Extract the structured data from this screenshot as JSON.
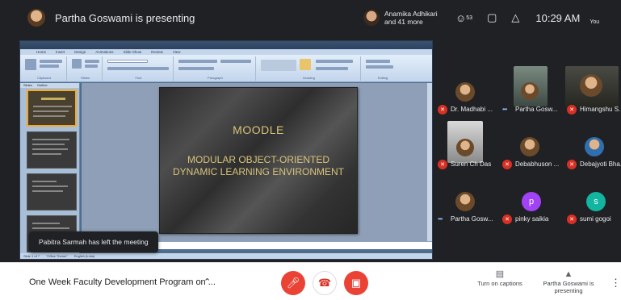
{
  "top": {
    "presenter_label": "Partha Goswami is presenting",
    "participants_text": "Anamika Adhikari and 41 more",
    "participant_count": "53",
    "time": "10:29 AM",
    "you_label": "You"
  },
  "ppt": {
    "tabs": [
      "Home",
      "Insert",
      "Design",
      "Animations",
      "Slide Show",
      "Review",
      "View"
    ],
    "ribbon_groups": [
      "Clipboard",
      "Slides",
      "Font",
      "Paragraph",
      "Drawing",
      "Editing"
    ],
    "thumb_tabs": [
      "Slides",
      "Outline"
    ],
    "status": [
      "Slide 1 of 7",
      "\"Office Theme\"",
      "English (India)"
    ]
  },
  "slide": {
    "title": "MOODLE",
    "subtitle": "MODULAR OBJECT-ORIENTED DYNAMIC LEARNING ENVIRONMENT"
  },
  "toast": "Pabitra Sarmah has left the meeting",
  "tiles": [
    {
      "name": "Dr. Madhabi ...",
      "status": "muted"
    },
    {
      "name": "Partha Gosw...",
      "status": "speaking"
    },
    {
      "name": "Himangshu S...",
      "status": "muted"
    },
    {
      "name": "Suren Ch Das",
      "status": "muted"
    },
    {
      "name": "Debabhuson ...",
      "status": "muted"
    },
    {
      "name": "Debajyoti Bha...",
      "status": "muted"
    },
    {
      "name": "Partha Gosw...",
      "status": "speaking"
    },
    {
      "name": "pinky saikia",
      "initial": "p",
      "color": "#a142f4",
      "status": "muted"
    },
    {
      "name": "sumi gogoi",
      "initial": "s",
      "color": "#12b5a0",
      "status": "muted"
    }
  ],
  "bottom": {
    "meeting_title": "One Week Faculty Development Program on ...",
    "captions_label": "Turn on captions",
    "presenting_label": "Partha Goswami is presenting"
  },
  "colors": {
    "dark_bg": "#202124",
    "end_call": "#ea4335",
    "muted_red": "#d93025",
    "slide_text": "#d9c37a"
  }
}
